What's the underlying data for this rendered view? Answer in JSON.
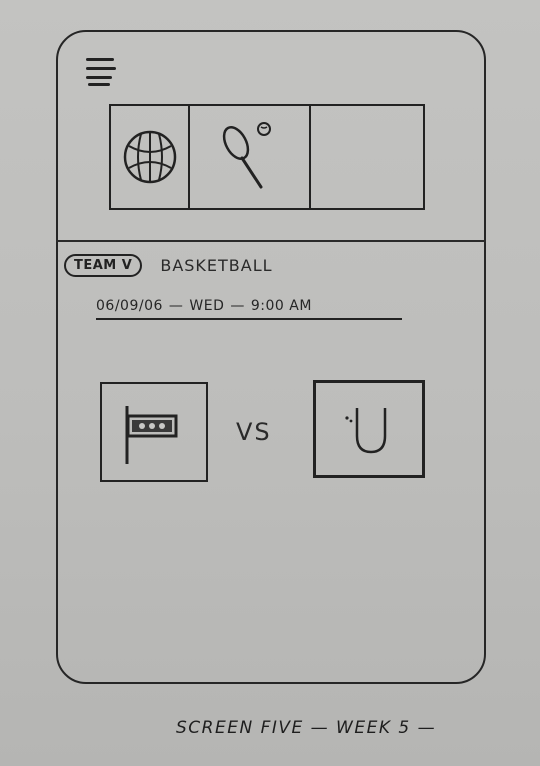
{
  "menu": {
    "icon": "hamburger-menu-icon"
  },
  "sports": [
    {
      "icon": "basketball-icon"
    },
    {
      "icon": "tennis-racket-icon"
    },
    {
      "icon": ""
    }
  ],
  "event": {
    "team_badge": "TEAM V",
    "sport": "BASKETBALL",
    "date": "06/09/06",
    "day": "WED",
    "time": "9:00 AM",
    "separator": "—"
  },
  "match": {
    "team_a_logo": "flag-logo-icon",
    "vs_label": "VS",
    "team_b_logo": "u-logo-icon"
  },
  "caption": "SCREEN FIVE — WEEK 5 — "
}
